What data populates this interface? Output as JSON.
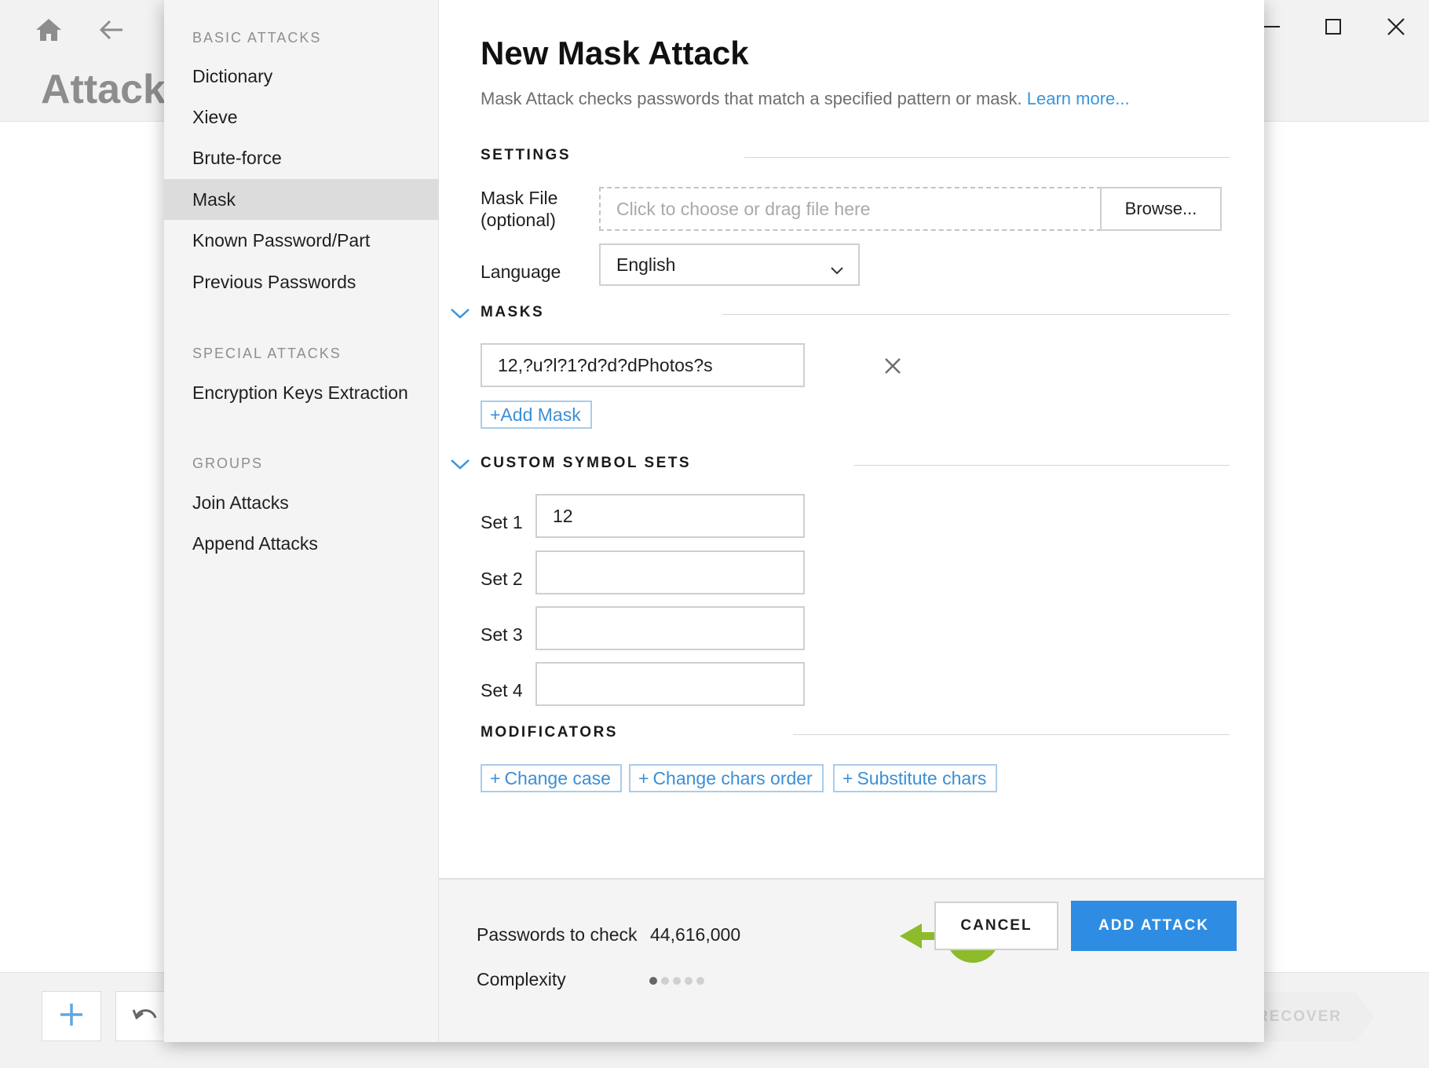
{
  "background": {
    "title": "Attack",
    "recover_label": "RECOVER"
  },
  "sidebar": {
    "groups": [
      {
        "heading": "BASIC ATTACKS",
        "items": [
          {
            "label": "Dictionary",
            "active": false
          },
          {
            "label": "Xieve",
            "active": false
          },
          {
            "label": "Brute-force",
            "active": false
          },
          {
            "label": "Mask",
            "active": true
          },
          {
            "label": "Known Password/Part",
            "active": false
          },
          {
            "label": "Previous Passwords",
            "active": false
          }
        ]
      },
      {
        "heading": "SPECIAL ATTACKS",
        "items": [
          {
            "label": "Encryption Keys Extraction",
            "active": false
          }
        ]
      },
      {
        "heading": "GROUPS",
        "items": [
          {
            "label": "Join Attacks",
            "active": false
          },
          {
            "label": "Append Attacks",
            "active": false
          }
        ]
      }
    ]
  },
  "main": {
    "title": "New Mask Attack",
    "subtitle": "Mask Attack checks passwords that match a specified pattern or mask.",
    "learn_more": "Learn more...",
    "settings": {
      "heading": "SETTINGS",
      "mask_file_label_1": "Mask File",
      "mask_file_label_2": "(optional)",
      "mask_file_placeholder": "Click to choose or drag file here",
      "browse_label": "Browse...",
      "language_label": "Language",
      "language_value": "English"
    },
    "masks": {
      "heading": "MASKS",
      "items": [
        "12,?u?l?1?d?d?dPhotos?s"
      ],
      "add_label": "+Add Mask"
    },
    "custom_sets": {
      "heading": "CUSTOM SYMBOL SETS",
      "sets": [
        {
          "label": "Set 1",
          "value": "12"
        },
        {
          "label": "Set 2",
          "value": ""
        },
        {
          "label": "Set 3",
          "value": ""
        },
        {
          "label": "Set 4",
          "value": ""
        }
      ]
    },
    "modificators": {
      "heading": "MODIFICATORS",
      "buttons": [
        "Change case",
        "Change chars order",
        "Substitute chars"
      ]
    }
  },
  "footer": {
    "passwords_label": "Passwords to check",
    "passwords_value": "44,616,000",
    "complexity_label": "Complexity",
    "complexity_level": 1,
    "complexity_max": 5,
    "cancel_label": "CANCEL",
    "add_label": "ADD ATTACK"
  },
  "colors": {
    "accent": "#2e8de2",
    "link": "#3a95db",
    "annotation": "#8dbb2b"
  },
  "icons": [
    "home-icon",
    "back-arrow-icon",
    "minimize-icon",
    "maximize-icon",
    "close-icon",
    "chevron-down-icon",
    "remove-icon",
    "plus-icon",
    "undo-icon",
    "annotation-arrow-icon"
  ]
}
